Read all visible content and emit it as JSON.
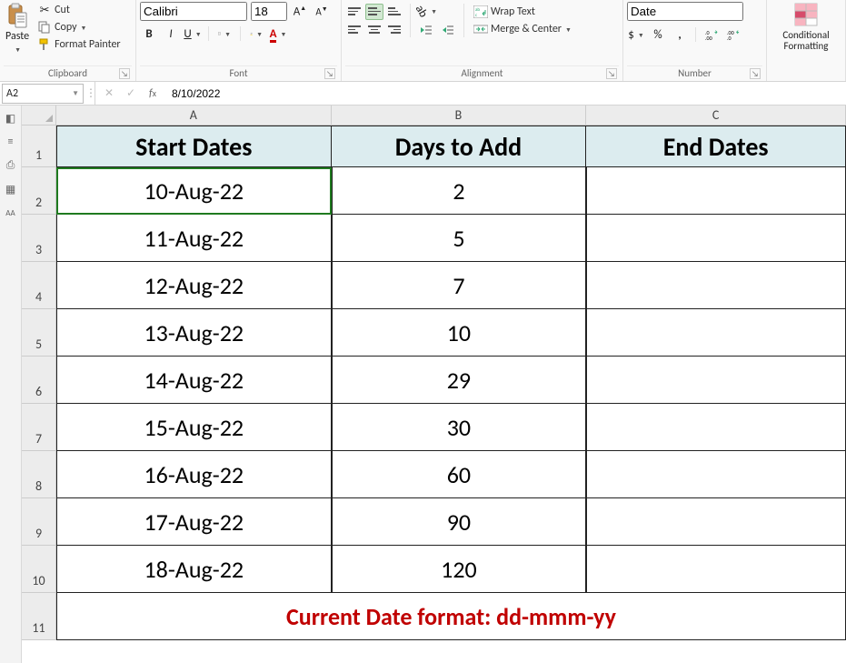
{
  "clipboard": {
    "paste": "Paste",
    "cut": "Cut",
    "copy": "Copy",
    "format_painter": "Format Painter",
    "group_label": "Clipboard"
  },
  "font": {
    "name": "Calibri",
    "size": "18",
    "group_label": "Font"
  },
  "alignment": {
    "wrap": "Wrap Text",
    "merge": "Merge & Center",
    "group_label": "Alignment"
  },
  "number": {
    "format": "Date",
    "currency": "$",
    "percent": "%",
    "comma": ",",
    "group_label": "Number"
  },
  "styles": {
    "cond_fmt": "Conditional\nFormatting"
  },
  "namebox": "A2",
  "formula": "8/10/2022",
  "columns": [
    "A",
    "B",
    "C"
  ],
  "rows": [
    "1",
    "2",
    "3",
    "4",
    "5",
    "6",
    "7",
    "8",
    "9",
    "10",
    "11"
  ],
  "sheet": {
    "headers": [
      "Start Dates",
      "Days to Add",
      "End Dates"
    ],
    "data": [
      {
        "a": "10-Aug-22",
        "b": "2",
        "c": ""
      },
      {
        "a": "11-Aug-22",
        "b": "5",
        "c": ""
      },
      {
        "a": "12-Aug-22",
        "b": "7",
        "c": ""
      },
      {
        "a": "13-Aug-22",
        "b": "10",
        "c": ""
      },
      {
        "a": "14-Aug-22",
        "b": "29",
        "c": ""
      },
      {
        "a": "15-Aug-22",
        "b": "30",
        "c": ""
      },
      {
        "a": "16-Aug-22",
        "b": "60",
        "c": ""
      },
      {
        "a": "17-Aug-22",
        "b": "90",
        "c": ""
      },
      {
        "a": "18-Aug-22",
        "b": "120",
        "c": ""
      }
    ],
    "note": "Current Date format: dd-mmm-yy"
  },
  "chart_data": {
    "type": "table",
    "columns": [
      "Start Dates",
      "Days to Add",
      "End Dates"
    ],
    "rows": [
      [
        "10-Aug-22",
        2,
        ""
      ],
      [
        "11-Aug-22",
        5,
        ""
      ],
      [
        "12-Aug-22",
        7,
        ""
      ],
      [
        "13-Aug-22",
        10,
        ""
      ],
      [
        "14-Aug-22",
        29,
        ""
      ],
      [
        "15-Aug-22",
        30,
        ""
      ],
      [
        "16-Aug-22",
        60,
        ""
      ],
      [
        "17-Aug-22",
        90,
        ""
      ],
      [
        "18-Aug-22",
        120,
        ""
      ]
    ],
    "note": "Current Date format: dd-mmm-yy"
  }
}
